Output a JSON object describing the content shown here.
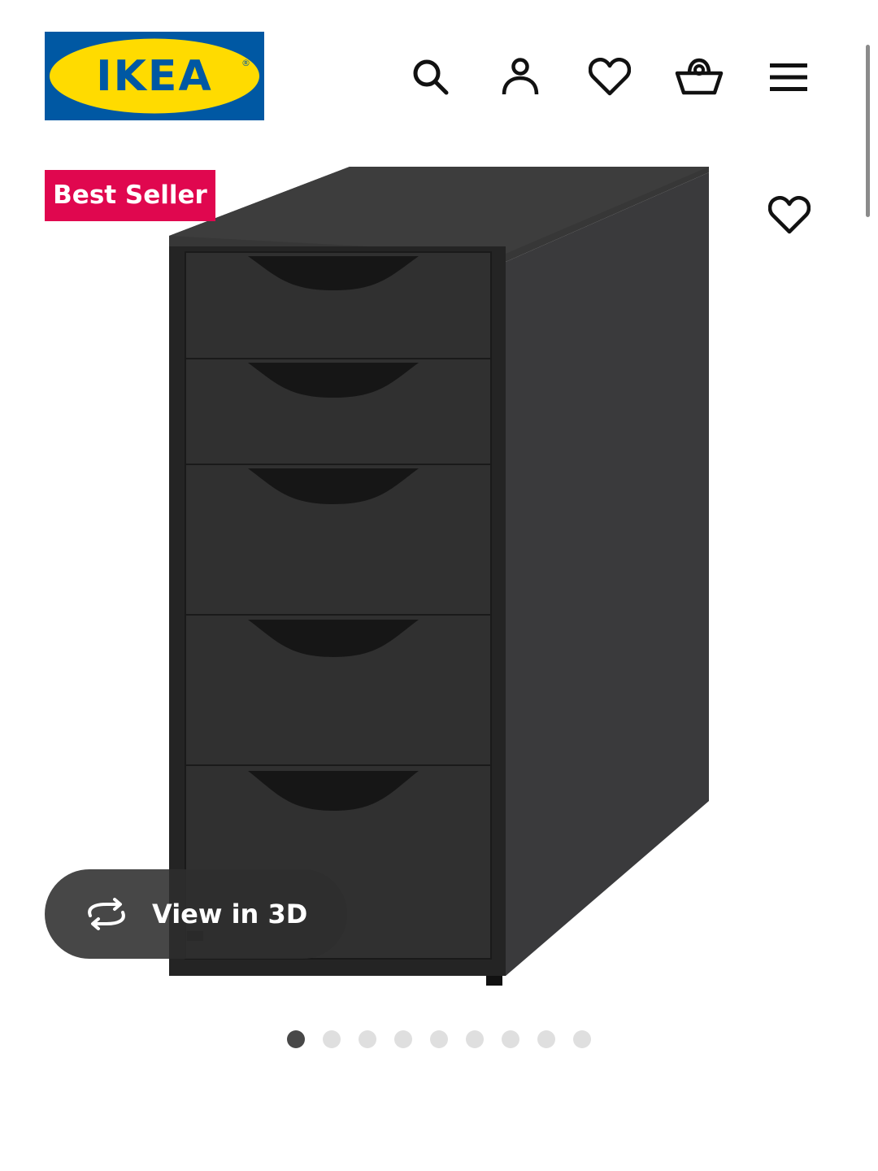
{
  "header": {
    "logo_text": "IKEA",
    "icons": [
      "search-icon",
      "account-icon",
      "heart-icon",
      "basket-icon",
      "hamburger-menu-icon"
    ]
  },
  "product": {
    "badge": "Best Seller",
    "favourite_icon": "heart-icon",
    "view_3d_label": "View in 3D",
    "image_count": 9,
    "active_image_index": 0
  },
  "colors": {
    "brand_blue": "#0058a3",
    "brand_yellow": "#ffdb00",
    "badge_red": "#e0074f",
    "dot_active": "#484848",
    "dot_inactive": "#dfdfdf"
  }
}
